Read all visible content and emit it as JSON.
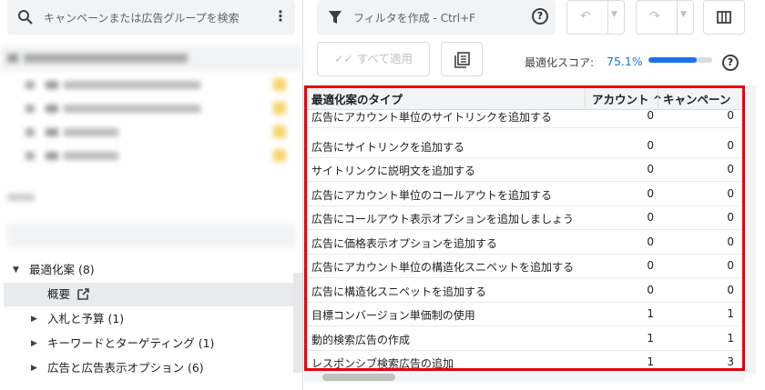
{
  "left": {
    "search_placeholder": "キャンペーンまたは広告グループを検索",
    "tree": [
      {
        "label": "最適化案 (8)",
        "expanded": true
      },
      {
        "label": "概要",
        "selected": true
      },
      {
        "label": "入札と予算 (1)"
      },
      {
        "label": "キーワードとターゲティング (1)"
      },
      {
        "label": "広告と広告表示オプション (6)"
      }
    ]
  },
  "toolbar": {
    "filter_placeholder": "フィルタを作成 - Ctrl+F",
    "apply_all_label": "すべて適用",
    "score_label": "最適化スコア:",
    "score_value": "75.1%",
    "score_fraction": 0.751
  },
  "table": {
    "headers": [
      "最適化案のタイプ",
      "アカウント",
      "キャンペーン"
    ],
    "rows": [
      [
        "広告にアカウント単位のサイトリンクを追加する",
        "0",
        "0"
      ],
      [
        "広告にサイトリンクを追加する",
        "0",
        "0"
      ],
      [
        "サイトリンクに説明文を追加する",
        "0",
        "0"
      ],
      [
        "広告にアカウント単位のコールアウトを追加する",
        "0",
        "0"
      ],
      [
        "広告にコールアウト表示オプションを追加しましょう",
        "0",
        "0"
      ],
      [
        "広告に価格表示オプションを追加する",
        "0",
        "0"
      ],
      [
        "広告にアカウント単位の構造化スニペットを追加する",
        "0",
        "0"
      ],
      [
        "広告に構造化スニペットを追加する",
        "0",
        "0"
      ],
      [
        "目標コンバージョン単価制の使用",
        "1",
        "1"
      ],
      [
        "動的検索広告の作成",
        "1",
        "1"
      ],
      [
        "レスポンシブ検索広告の追加",
        "1",
        "3"
      ]
    ]
  }
}
